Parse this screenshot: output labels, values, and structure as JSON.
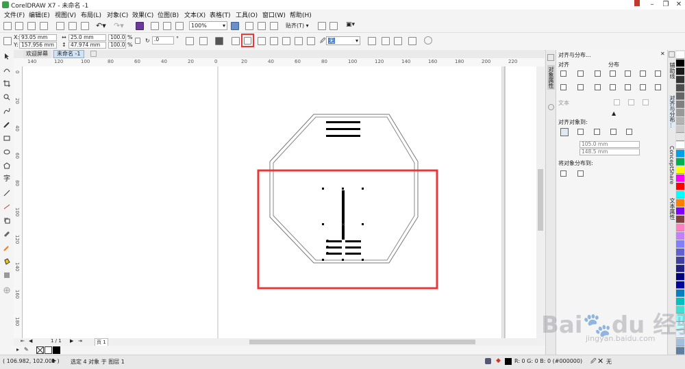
{
  "window": {
    "title": "CorelDRAW X7 - 未命名 -1"
  },
  "menu": [
    "文件(F)",
    "编辑(E)",
    "视图(V)",
    "布局(L)",
    "对象(C)",
    "效果(C)",
    "位图(B)",
    "文本(X)",
    "表格(T)",
    "工具(O)",
    "窗口(W)",
    "帮助(H)"
  ],
  "toolbar": {
    "zoom": "100%",
    "snap_label": "贴齐(T)"
  },
  "property_bar": {
    "x": "93.05 mm",
    "y": "157.956 mm",
    "x_label": "X:",
    "y_label": "Y:",
    "width": "25.0 mm",
    "height": "47.974 mm",
    "scale_w": "100.0",
    "scale_h": "100.0",
    "percent": "%",
    "rotation": ".0",
    "degree": "°",
    "outline_value": "无"
  },
  "tabs": {
    "welcome": "欢迎屏幕",
    "document": "未命名 -1"
  },
  "rulers": {
    "h_labels": [
      "140",
      "120",
      "100",
      "80",
      "60",
      "40",
      "20",
      "0",
      "20",
      "40",
      "60",
      "80",
      "100",
      "120",
      "140",
      "160",
      "180",
      "200",
      "220"
    ],
    "v_labels": [
      "0",
      "20",
      "40",
      "60",
      "80",
      "100",
      "120",
      "140",
      "160",
      "180"
    ]
  },
  "page_nav": {
    "counter": "1 / 1",
    "page_tab": "页 1"
  },
  "docker": {
    "panel_title": "对齐与分布...",
    "align_header": "对齐",
    "distribute_header": "分布",
    "text_header": "文本",
    "align_to_header": "对齐对象到:",
    "value1": "105.0 mm",
    "value2": "148.5 mm",
    "distribute_to_header": "将对象分布到:",
    "side_tab_object_props": "对象属性",
    "right_tabs": [
      "辅助线",
      "对齐与分布...",
      "ConceptShare",
      "文本属性"
    ]
  },
  "status": {
    "coords": "( 106.982, 102.001 )",
    "selection": "选定 4 对象 于 图层 1",
    "fill_info": "R: 0 G: 0 B: 0 (#000000)",
    "outline": "无"
  },
  "watermark": {
    "main": "Bai🐾du 经验",
    "sub": "jingyan.baidu.com"
  },
  "colors": {
    "highlight": "#e8393a",
    "palette": [
      "#ffffff",
      "#000000",
      "#1a1a1a",
      "#333333",
      "#4d4d4d",
      "#666666",
      "#808080",
      "#999999",
      "#b3b3b3",
      "#cccccc",
      "#e6e6e6",
      "#ffffff",
      "#00a0e9",
      "#00b050",
      "#ffff00",
      "#ff00ff",
      "#ff0000",
      "#00ffff",
      "#ff8000",
      "#8000ff",
      "#804040",
      "#ff80c0",
      "#c080ff",
      "#8080ff",
      "#6060d0",
      "#4040a0",
      "#202080",
      "#000080",
      "#0000a0",
      "#0080c0",
      "#00c0c0",
      "#40e0d0",
      "#80ffff",
      "#c0ffff",
      "#e0f0ff",
      "#a0c0e0",
      "#6080a0"
    ]
  }
}
